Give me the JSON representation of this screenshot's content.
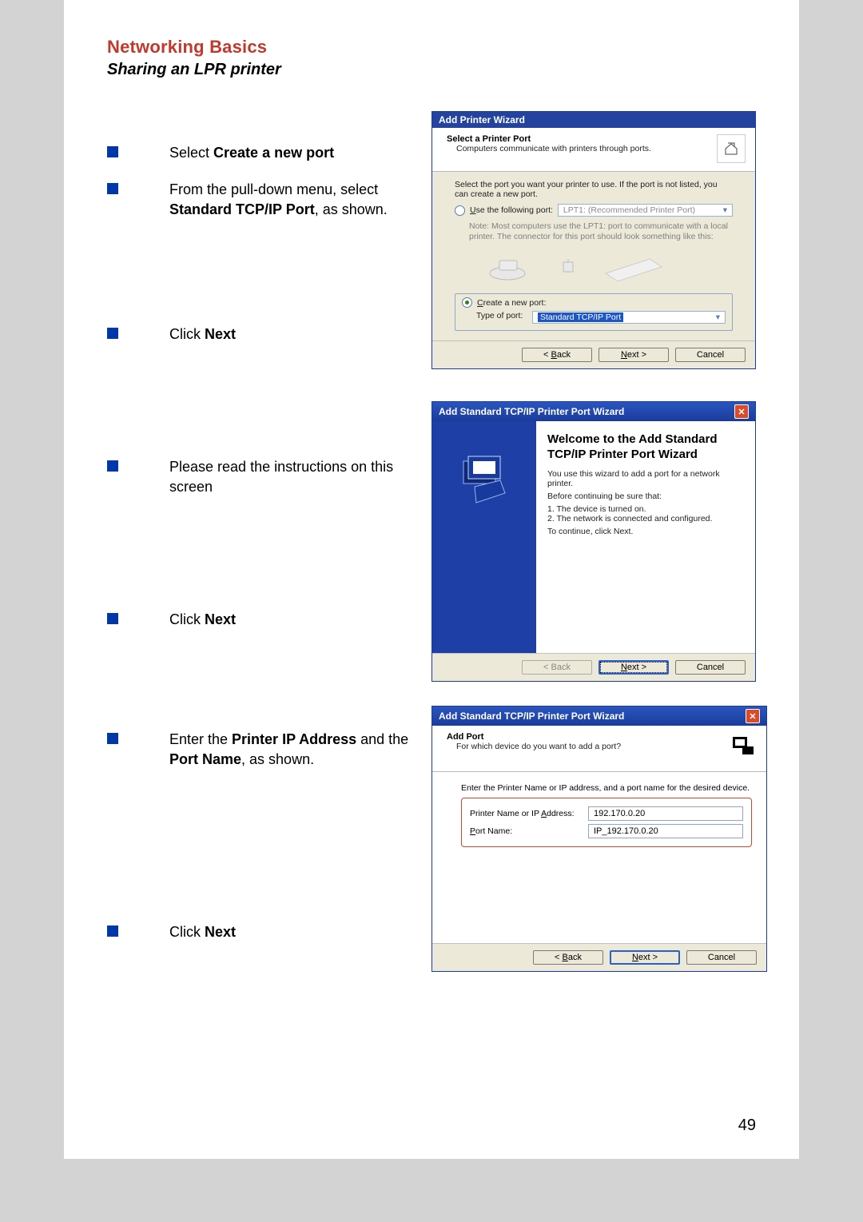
{
  "title": "Networking Basics",
  "subtitle": "Sharing an LPR printer",
  "page_number": "49",
  "instructions": {
    "step1_pre": "Select ",
    "step1_bold": "Create a new port",
    "step2_pre": "From the pull-down menu, select ",
    "step2_bold": "Standard TCP/IP Port",
    "step2_post": ", as shown.",
    "step3_pre": "Click ",
    "step3_bold": "Next",
    "step4": "Please read the instructions on this screen",
    "step5_pre": "Click ",
    "step5_bold": "Next",
    "step6_pre": "Enter the ",
    "step6_bold1": "Printer IP Address",
    "step6_mid": " and the ",
    "step6_bold2": "Port Name",
    "step6_post": ", as shown.",
    "step7_pre": "Click ",
    "step7_bold": "Next"
  },
  "wizard1": {
    "title": "Add Printer Wizard",
    "head_t1": "Select a Printer Port",
    "head_t2": "Computers communicate with printers through ports.",
    "body_intro": "Select the port you want your printer to use.  If the port is not listed, you can create a new port.",
    "radio_use_label_u": "U",
    "radio_use_label": "se the following port:",
    "use_port_value": "LPT1: (Recommended Printer Port)",
    "note1": "Note: Most computers use the LPT1: port to communicate with a local printer. The connector for this port should look something like this:",
    "radio_create_label_u": "C",
    "radio_create_label": "reate a new port:",
    "type_of_port_label": "Type of port:",
    "type_of_port_value": "Standard TCP/IP Port",
    "btn_back_u": "B",
    "btn_back": "ack",
    "btn_next_u": "N",
    "btn_next": "ext >",
    "btn_cancel": "Cancel"
  },
  "wizard2": {
    "title": "Add Standard TCP/IP Printer Port Wizard",
    "welcome_h": "Welcome to the Add Standard TCP/IP Printer Port Wizard",
    "p1": "You use this wizard to add a port for a network printer.",
    "p2": "Before continuing be sure that:",
    "l1": "1.  The device is turned on.",
    "l2": "2.  The network is connected and configured.",
    "continue": "To continue, click Next.",
    "btn_back": "< Back",
    "btn_next_u": "N",
    "btn_next": "ext >",
    "btn_cancel": "Cancel"
  },
  "wizard3": {
    "title": "Add Standard TCP/IP Printer Port Wizard",
    "head_t1": "Add Port",
    "head_t2": "For which device do you want to add a port?",
    "intro": "Enter the Printer Name or IP address, and a port name for the desired device.",
    "addr_label_pre": "Printer Name or IP ",
    "addr_label_u": "A",
    "addr_label_post": "ddress:",
    "addr_value": "192.170.0.20",
    "portname_label_u": "P",
    "portname_label": "ort Name:",
    "portname_value": "IP_192.170.0.20",
    "btn_back_u": "B",
    "btn_back": "ack",
    "btn_next_u": "N",
    "btn_next": "ext >",
    "btn_cancel": "Cancel"
  }
}
